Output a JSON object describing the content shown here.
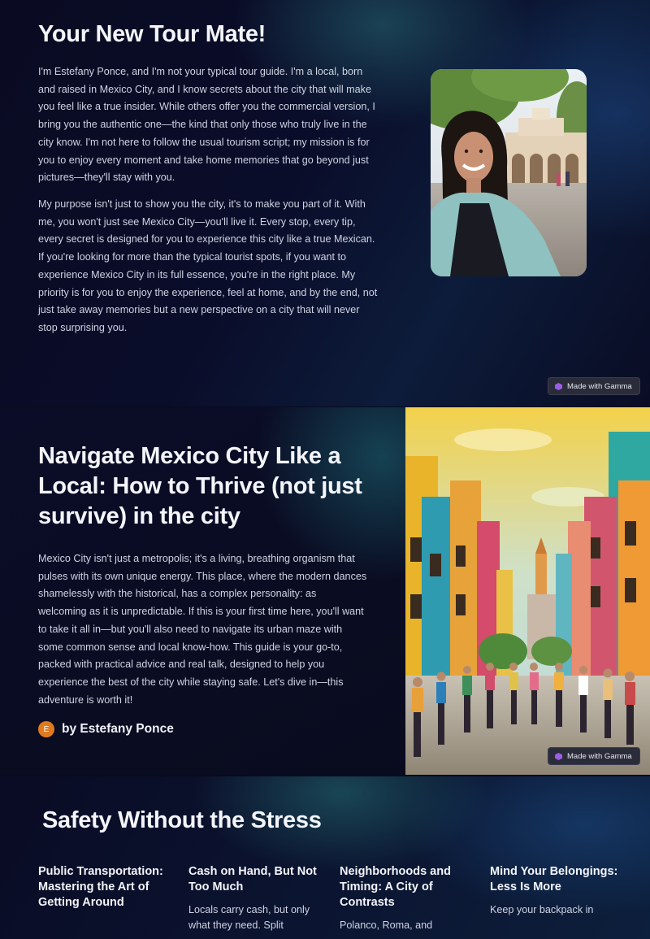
{
  "section1": {
    "title": "Your New Tour Mate!",
    "paragraph1": "I'm Estefany Ponce, and I'm not your typical tour guide. I'm a local, born and raised in Mexico City, and I know secrets about the city that will make you feel like a true insider. While others offer you the commercial version, I bring you the authentic one—the kind that only those who truly live in the city know. I'm not here to follow the usual tourism script; my mission is for you to enjoy every moment and take home memories that go beyond just pictures—they'll stay with you.",
    "paragraph2": "My purpose isn't just to show you the city, it's to make you part of it. With me, you won't just see Mexico City—you'll live it. Every stop, every tip, every secret is designed for you to experience this city like a true Mexican. If you're looking for more than the typical tourist spots, if you want to experience Mexico City in its full essence, you're in the right place. My priority is for you to enjoy the experience, feel at home, and by the end, not just take away memories but a new perspective on a city that will never stop surprising you."
  },
  "badge": {
    "label": "Made with Gamma"
  },
  "section2": {
    "title": "Navigate Mexico City Like a Local: How to Thrive (not just survive) in the city",
    "paragraph": "Mexico City isn't just a metropolis; it's a living, breathing organism that pulses with its own unique energy. This place, where the modern dances shamelessly with the historical, has a complex personality: as welcoming as it is unpredictable. If this is your first time here, you'll want to take it all in—but you'll also need to navigate its urban maze with some common sense and local know-how. This guide is your go-to, packed with practical advice and real talk, designed to help you experience the best of the city while staying safe. Let's dive in—this adventure is worth it!",
    "avatar_initial": "E",
    "byline": "by Estefany Ponce"
  },
  "section3": {
    "title": "Safety Without the Stress",
    "columns": [
      {
        "heading": "Public Transportation: Mastering the Art of Getting Around",
        "text": ""
      },
      {
        "heading": "Cash on Hand, But Not Too Much",
        "text": "Locals carry cash, but only what they need. Split"
      },
      {
        "heading": "Neighborhoods and Timing: A City of Contrasts",
        "text": "Polanco, Roma, and"
      },
      {
        "heading": "Mind Your Belongings: Less Is More",
        "text": "Keep your backpack in"
      }
    ]
  },
  "colors": {
    "avatar": "#e07a1f",
    "background": "#080a1c",
    "badge_bg": "#2a2c3a",
    "gamma_icon": "#9b5de5"
  }
}
